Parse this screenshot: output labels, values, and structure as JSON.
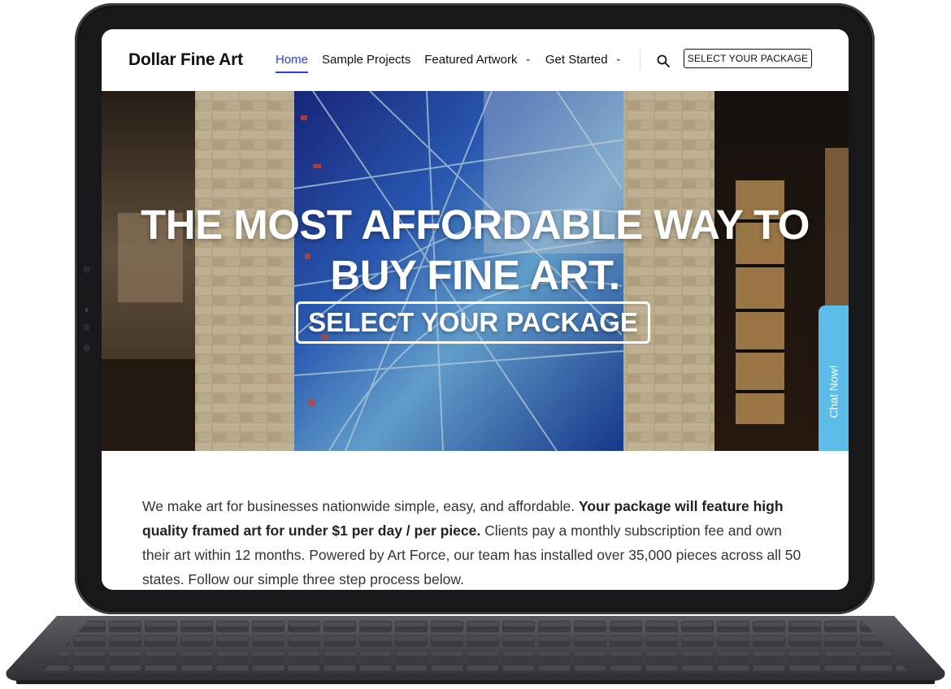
{
  "site": {
    "logo": "Dollar Fine Art"
  },
  "nav": {
    "items": [
      {
        "label": "Home",
        "active": true
      },
      {
        "label": "Sample Projects",
        "active": false
      },
      {
        "label": "Featured Artwork",
        "active": false,
        "dropdown": true
      },
      {
        "label": "Get Started",
        "active": false,
        "dropdown": true
      }
    ],
    "cta_label": "SELECT YOUR PACKAGE"
  },
  "hero": {
    "title_line1": "THE MOST AFFORDABLE WAY TO",
    "title_line2": "BUY FINE ART.",
    "cta_label": "SELECT YOUR PACKAGE"
  },
  "chat": {
    "label": "Chat Now!"
  },
  "intro": {
    "part1": "We make art for businesses nationwide simple, easy, and affordable. ",
    "bold": "Your package will feature high quality framed art for under $1 per day / per piece.",
    "part2": " Clients pay a monthly subscription fee and own their art within 12 months. Powered by Art Force, our team has installed over 35,000 pieces across all 50 states. Follow our simple three step process below."
  },
  "colors": {
    "nav_active": "#2b3fe0",
    "chat_tab": "#5bbde8",
    "device_frame": "#18181a"
  },
  "icons": [
    "search-icon",
    "chevron-down-icon"
  ]
}
